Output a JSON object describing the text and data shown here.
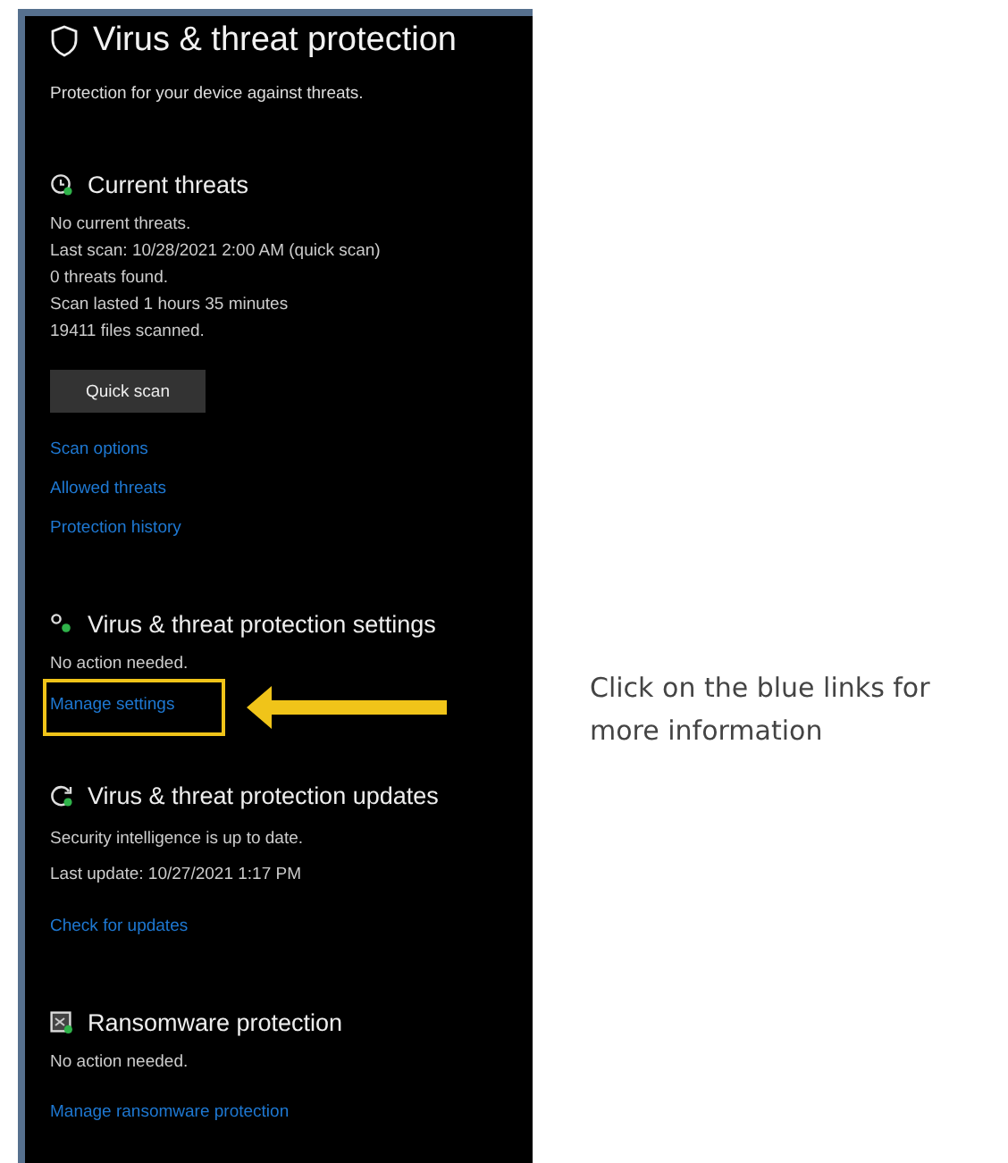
{
  "panel": {
    "title": "Virus & threat protection",
    "subtitle": "Protection for your device against threats.",
    "sections": [
      {
        "kind": "threats",
        "title": "Current threats",
        "lines": [
          "No current threats.",
          "Last scan: 10/28/2021 2:00 AM (quick scan)",
          "0 threats found.",
          "Scan lasted 1 hours 35 minutes",
          "19411 files scanned."
        ],
        "button": "Quick scan",
        "links": [
          {
            "label": "Scan options",
            "highlighted": false
          },
          {
            "label": "Allowed threats",
            "highlighted": false
          },
          {
            "label": "Protection history",
            "highlighted": false
          }
        ]
      },
      {
        "kind": "settings",
        "title": "Virus & threat protection settings",
        "lines": [
          "No action needed."
        ],
        "links": [
          {
            "label": "Manage settings",
            "highlighted": true
          }
        ]
      },
      {
        "kind": "updates",
        "title": "Virus & threat protection updates",
        "lines": [
          "Security intelligence is up to date.",
          "Last update: 10/27/2021 1:17 PM"
        ],
        "links": [
          {
            "label": "Check for updates",
            "highlighted": false
          }
        ]
      },
      {
        "kind": "ransomware",
        "title": "Ransomware protection",
        "lines": [
          "No action needed."
        ],
        "links": [
          {
            "label": "Manage ransomware protection",
            "highlighted": false
          }
        ]
      }
    ]
  },
  "annotation": {
    "text": "Click on the blue links for more information"
  }
}
